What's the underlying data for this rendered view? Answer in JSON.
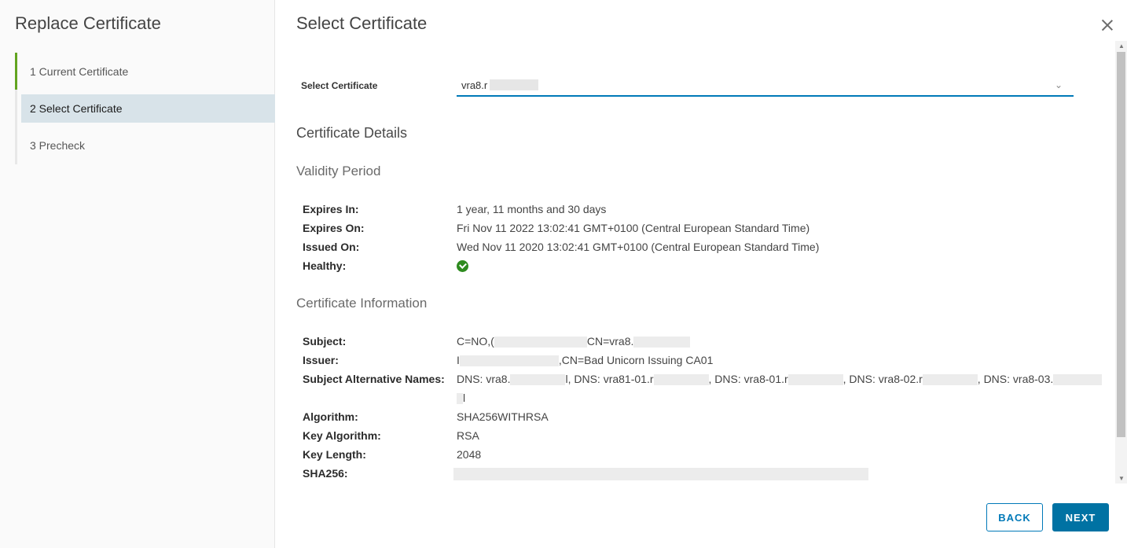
{
  "sidebar": {
    "title": "Replace Certificate",
    "steps": [
      {
        "label": "1 Current Certificate"
      },
      {
        "label": "2 Select Certificate"
      },
      {
        "label": "3 Precheck"
      }
    ]
  },
  "main": {
    "title": "Select Certificate",
    "select": {
      "label": "Select Certificate",
      "value": "vra8.r"
    },
    "details_heading": "Certificate Details",
    "validity": {
      "heading": "Validity Period",
      "expires_in_label": "Expires In:",
      "expires_in": "1 year, 11 months and 30 days",
      "expires_on_label": "Expires On:",
      "expires_on": "Fri Nov 11 2022 13:02:41 GMT+0100 (Central European Standard Time)",
      "issued_on_label": "Issued On:",
      "issued_on": "Wed Nov 11 2020 13:02:41 GMT+0100 (Central European Standard Time)",
      "healthy_label": "Healthy:"
    },
    "info": {
      "heading": "Certificate Information",
      "subject_label": "Subject:",
      "subject_a": "C=NO,(",
      "subject_b": "CN=vra8.",
      "issuer_label": "Issuer:",
      "issuer_a": "I",
      "issuer_b": ",CN=Bad Unicorn Issuing CA01",
      "san_label": "Subject Alternative Names:",
      "san_1": "DNS: vra8.",
      "san_2": "l, DNS: vra81-01.r",
      "san_3": ", DNS: vra8-01.r",
      "san_4": ", DNS: vra8-02.r",
      "san_5": ", DNS: vra8-03.",
      "san_line2": "l",
      "algorithm_label": "Algorithm:",
      "algorithm": "SHA256WITHRSA",
      "key_algorithm_label": "Key Algorithm:",
      "key_algorithm": "RSA",
      "key_length_label": "Key Length:",
      "key_length": "2048",
      "sha256_label": "SHA256:"
    }
  },
  "footer": {
    "back_label": "BACK",
    "next_label": "NEXT"
  },
  "colors": {
    "accent": "#0079b8",
    "primary_button": "#0072a3",
    "done_step": "#62a420",
    "active_step_bg": "#d8e3e9",
    "healthy": "#2e8b1f"
  }
}
